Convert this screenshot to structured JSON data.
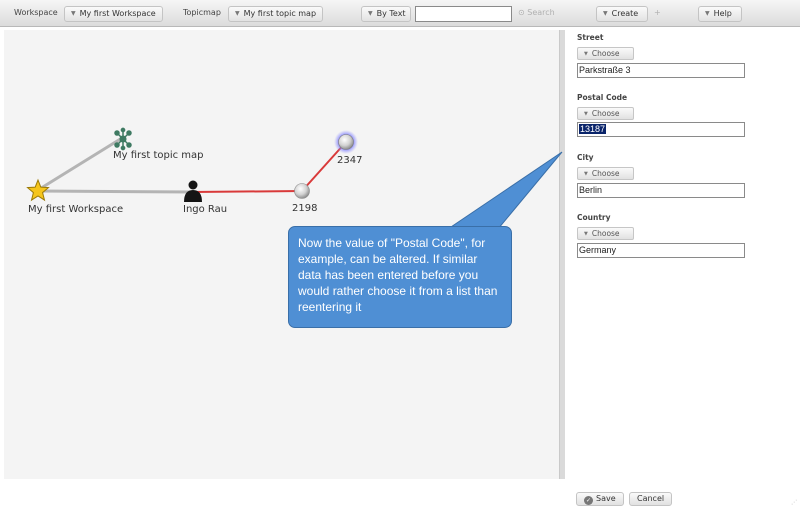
{
  "toolbar": {
    "workspace_label": "Workspace",
    "workspace_value": "My first Workspace",
    "topicmap_label": "Topicmap",
    "topicmap_value": "My first topic map",
    "search_mode": "By Text",
    "search_value": "",
    "search_button": "Search",
    "create_button": "Create",
    "help_button": "Help"
  },
  "graph": {
    "nodes": [
      {
        "id": "workspace",
        "label": "My first Workspace",
        "icon": "star-icon"
      },
      {
        "id": "topicmap",
        "label": "My first topic map",
        "icon": "topicmap-icon"
      },
      {
        "id": "person",
        "label": "Ingo Rau",
        "icon": "person-icon"
      },
      {
        "id": "address",
        "label": "2198",
        "icon": "sphere-icon"
      },
      {
        "id": "postal",
        "label": "2347",
        "icon": "sphere-icon"
      }
    ],
    "edge_colors": {
      "default": "#b4b4b4",
      "highlight": "#d93a3a"
    }
  },
  "detail": {
    "fields": [
      {
        "label": "Street",
        "choose": "Choose",
        "value": "Parkstraße 3"
      },
      {
        "label": "Postal Code",
        "choose": "Choose",
        "value": "13187"
      },
      {
        "label": "City",
        "choose": "Choose",
        "value": "Berlin"
      },
      {
        "label": "Country",
        "choose": "Choose",
        "value": "Germany"
      }
    ],
    "save_button": "Save",
    "cancel_button": "Cancel"
  },
  "callout": {
    "text": "Now the value of \"Postal Code\", for example, can be altered. If similar data has been entered before you would rather choose it from a list than reentering it"
  },
  "colors": {
    "callout": "#4f8fd4",
    "selection": "#0a246a",
    "canvas": "#f4f4f4"
  }
}
